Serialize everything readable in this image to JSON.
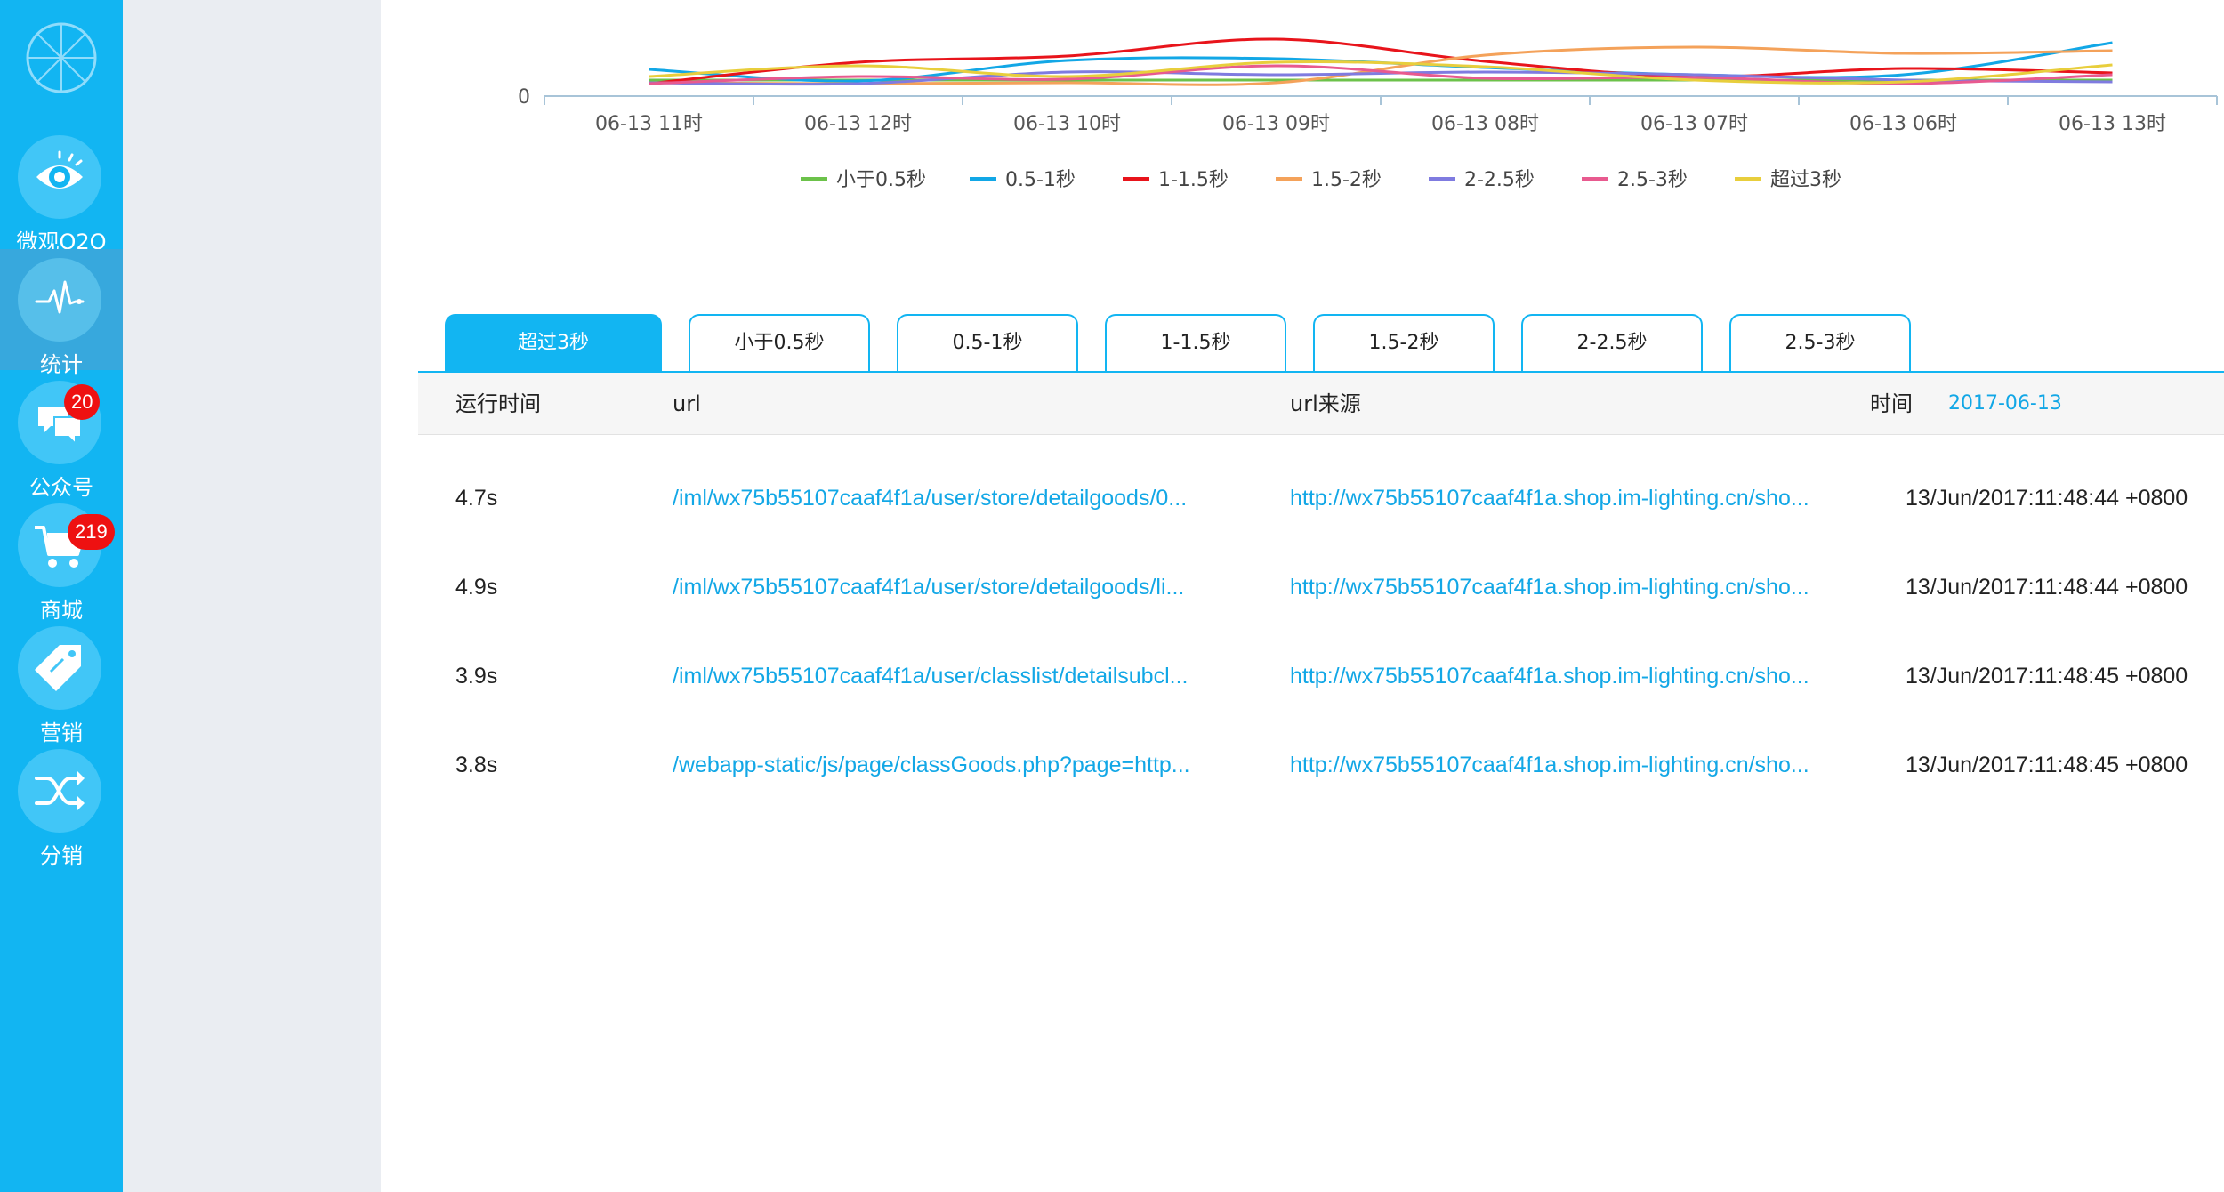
{
  "colors": {
    "accent": "#12b5f2",
    "nav_active": "#37a8dd",
    "link": "#12a7e6",
    "badge": "#ee1111"
  },
  "nav": {
    "items": [
      {
        "label": "微观O2O",
        "icon": "eye-icon"
      },
      {
        "label": "统计",
        "icon": "pulse-icon",
        "active": true
      },
      {
        "label": "公众号",
        "icon": "chat-icon",
        "badge": "20"
      },
      {
        "label": "商城",
        "icon": "cart-icon",
        "badge": "219"
      },
      {
        "label": "营销",
        "icon": "tag-icon"
      },
      {
        "label": "分销",
        "icon": "shuffle-icon"
      }
    ]
  },
  "chart_data": {
    "type": "line",
    "categories": [
      "06-13 11时",
      "06-13 12时",
      "06-13 10时",
      "06-13 09时",
      "06-13 08时",
      "06-13 07时",
      "06-13 06时",
      "06-13 13时"
    ],
    "y_tick_labels": [
      "0"
    ],
    "legend_position": "bottom-center",
    "series": [
      {
        "name": "小于0.5秒",
        "color": "#6cc24a",
        "values": [
          0.6,
          0.6,
          0.6,
          0.6,
          0.6,
          0.6,
          0.6,
          0.6
        ]
      },
      {
        "name": "0.5-1秒",
        "color": "#12a7e6",
        "values": [
          1.8,
          0.5,
          2.8,
          3.0,
          2.0,
          1.2,
          1.2,
          4.8
        ]
      },
      {
        "name": "1-1.5秒",
        "color": "#e8141b",
        "values": [
          0.2,
          2.6,
          3.3,
          5.2,
          2.7,
          1.0,
          1.9,
          1.4
        ]
      },
      {
        "name": "1.5-2秒",
        "color": "#f4a25a",
        "values": [
          0.3,
          0.2,
          0.3,
          0.3,
          3.4,
          4.3,
          3.6,
          3.9
        ]
      },
      {
        "name": "2-2.5秒",
        "color": "#7f7be0",
        "values": [
          0.3,
          0.2,
          1.5,
          1.2,
          1.5,
          1.2,
          0.6,
          0.4
        ]
      },
      {
        "name": "2.5-3秒",
        "color": "#e85a8f",
        "values": [
          0.2,
          1.0,
          0.7,
          2.2,
          0.8,
          0.9,
          0.2,
          1.2
        ]
      },
      {
        "name": "超过3秒",
        "color": "#e8ce3c",
        "values": [
          1.0,
          2.2,
          1.0,
          2.6,
          2.1,
          0.6,
          0.4,
          2.3
        ]
      }
    ]
  },
  "tabs": {
    "items": [
      "超过3秒",
      "小于0.5秒",
      "0.5-1秒",
      "1-1.5秒",
      "1.5-2秒",
      "2-2.5秒",
      "2.5-3秒"
    ],
    "active_index": 0
  },
  "table": {
    "headers": {
      "runtime": "运行时间",
      "url": "url",
      "source": "url来源",
      "time": "时间"
    },
    "date_filter": "2017-06-13",
    "rows": [
      {
        "runtime": "4.7s",
        "url": "/iml/wx75b55107caaf4f1a/user/store/detailgoods/0...",
        "source": "http://wx75b55107caaf4f1a.shop.im-lighting.cn/sho...",
        "time": "13/Jun/2017:11:48:44 +0800"
      },
      {
        "runtime": "4.9s",
        "url": "/iml/wx75b55107caaf4f1a/user/store/detailgoods/li...",
        "source": "http://wx75b55107caaf4f1a.shop.im-lighting.cn/sho...",
        "time": "13/Jun/2017:11:48:44 +0800"
      },
      {
        "runtime": "3.9s",
        "url": "/iml/wx75b55107caaf4f1a/user/classlist/detailsubcl...",
        "source": "http://wx75b55107caaf4f1a.shop.im-lighting.cn/sho...",
        "time": "13/Jun/2017:11:48:45 +0800"
      },
      {
        "runtime": "3.8s",
        "url": "/webapp-static/js/page/classGoods.php?page=http...",
        "source": "http://wx75b55107caaf4f1a.shop.im-lighting.cn/sho...",
        "time": "13/Jun/2017:11:48:45 +0800"
      }
    ]
  }
}
